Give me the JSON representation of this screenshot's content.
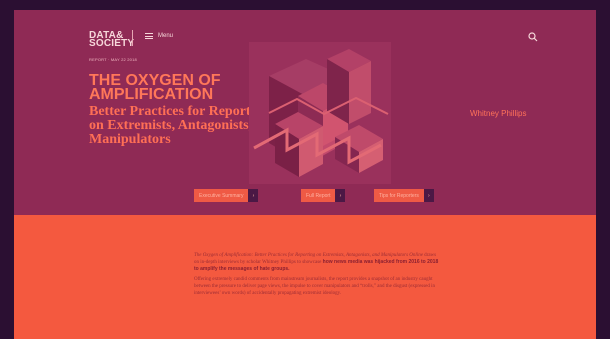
{
  "brand": {
    "logo_text": "DATA&\nSOCIETY",
    "menu_label": "Menu"
  },
  "header": {
    "meta": "REPORT · MAY 22 2018"
  },
  "report": {
    "title": "THE OXYGEN OF AMPLIFICATION",
    "subtitle": "Better Practices for Reporting on Extremists, Antagonists, and Manipulators",
    "author": "Whitney Phillips"
  },
  "actions": [
    {
      "label": "Executive Summary",
      "arrow": "›"
    },
    {
      "label": "Full Report",
      "arrow": "›"
    },
    {
      "label": "Tips for Reporters",
      "arrow": "›"
    }
  ],
  "body": {
    "p1_title": "The Oxygen of Amplification: Better Practices for Reporting on Extremists, Antagonists, and Manipulators Online",
    "p1_rest": " draws on in-depth interviews by scholar Whitney Phillips to showcase ",
    "p1_bold": "how news media was hijacked from 2016 to 2018 to amplify the messages of hate groups.",
    "p2": "Offering extremely candid comments from mainstream journalists, the report provides a snapshot of an industry caught between the pressure to deliver page views, the impulse to cover manipulators and “trolls,” and the disgust (expressed in interviewees’ own words) of accidentally propagating extremist ideology."
  },
  "colors": {
    "hero": "#8f2a55",
    "lower": "#f4593f",
    "accent": "#ff7759",
    "button_arrow": "#4b1845"
  },
  "icons": {
    "search": "search-icon",
    "menu": "menu-icon",
    "arrow": "arrow-right-icon"
  }
}
